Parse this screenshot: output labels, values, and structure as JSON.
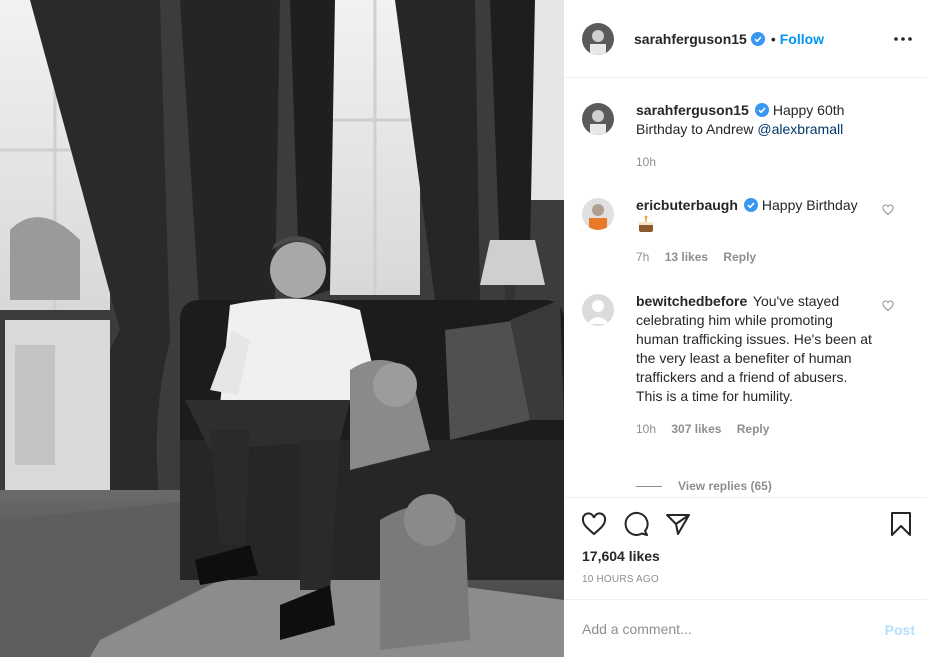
{
  "post": {
    "username": "sarahferguson15",
    "follow_label": "Follow",
    "separator": "•"
  },
  "comments": [
    {
      "username": "sarahferguson15",
      "text": "Happy 60th Birthday to Andrew ",
      "mention": "@alexbramall",
      "time": "10h"
    },
    {
      "username": "ericbuterbaugh",
      "text": "Happy Birthday ",
      "emoji": "birthday-cake",
      "time": "7h",
      "likes": "13 likes",
      "reply": "Reply"
    },
    {
      "username": "bewitchedbefore",
      "text": "You've stayed celebrating him while promoting human trafficking issues. He's been at the very least a benefiter of human traffickers and a friend of abusers. This is a time for humility.",
      "time": "10h",
      "likes": "307 likes",
      "reply": "Reply",
      "view_replies": "View replies (65)"
    }
  ],
  "actions": {
    "likes": "17,604 likes",
    "timestamp": "10 HOURS AGO",
    "icons": [
      "heart-icon",
      "comment-icon",
      "share-icon",
      "bookmark-icon"
    ]
  },
  "add_comment": {
    "placeholder": "Add a comment...",
    "post_label": "Post"
  },
  "colors": {
    "accent": "#0095f6",
    "mention": "#00376b",
    "muted": "#8e8e8e",
    "post_disabled": "#b2dffc",
    "verified": "#3897f0"
  }
}
